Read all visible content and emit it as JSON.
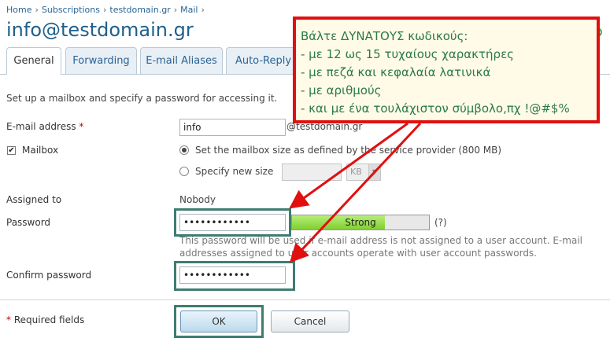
{
  "breadcrumb": [
    "Home",
    "Subscriptions",
    "testdomain.gr",
    "Mail"
  ],
  "breadcrumb_sep": "›",
  "page_title": "info@testdomain.gr",
  "tabs": [
    {
      "label": "General",
      "active": true
    },
    {
      "label": "Forwarding"
    },
    {
      "label": "E-mail Aliases"
    },
    {
      "label": "Auto-Reply"
    }
  ],
  "intro": "Set up a mailbox and specify a password for accessing it.",
  "email": {
    "label": "E-mail address",
    "required_mark": "*",
    "value": "info",
    "domain": "@testdomain.gr"
  },
  "mailbox": {
    "label": "Mailbox",
    "checked": true,
    "option_default": "Set the mailbox size as defined by the service provider (800 MB)",
    "option_custom": "Specify new size",
    "unit": "KB"
  },
  "assigned": {
    "label": "Assigned to",
    "value": "Nobody"
  },
  "password": {
    "label": "Password",
    "value": "••••••••••••",
    "strength_label": "Strong",
    "strength_level": 0.68,
    "help": "(?)",
    "hint": "This password will be used if e-mail address is not assigned to a user account. E-mail addresses assigned to user accounts operate with user account passwords."
  },
  "confirm": {
    "label": "Confirm password",
    "value": "••••••••••••"
  },
  "required_note": {
    "mark": "*",
    "text": "Required fields"
  },
  "buttons": {
    "ok": "OK",
    "cancel": "Cancel"
  },
  "callout": {
    "lines": [
      "Βάλτε ΔΥΝΑΤΟΥΣ κωδικούς:",
      "- με 12 ως 15 τυχαίους χαρακτήρες",
      "- με πεζά και κεφαλαία λατινικά",
      "- με αριθμούς",
      "- και με ένα τουλάχιστον σύμβολο,πχ !@#$%"
    ]
  },
  "colors": {
    "callout_border": "#e01010",
    "callout_text": "#2a7a4a",
    "highlight": "#3e7d71",
    "link": "#2a6496"
  }
}
